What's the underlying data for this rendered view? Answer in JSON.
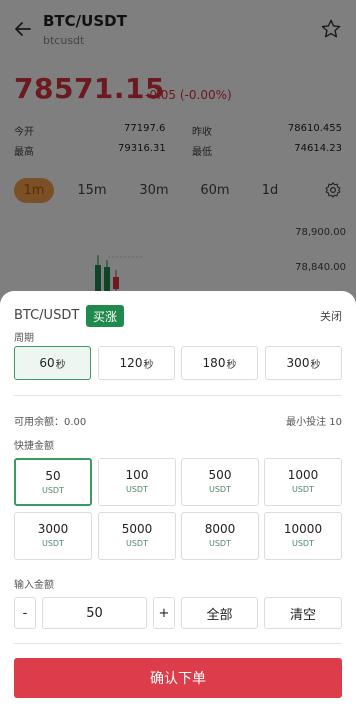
{
  "header": {
    "pair": "BTC/USDT",
    "symbol": "btcusdt"
  },
  "ticker": {
    "last_price": "78571.15",
    "change": "-0.05 (-0.00%)",
    "stats": [
      {
        "label": "今开",
        "value": "77197.6"
      },
      {
        "label": "昨收",
        "value": "78610.455"
      },
      {
        "label": "最高",
        "value": "79316.31"
      },
      {
        "label": "最低",
        "value": "74614.23"
      }
    ]
  },
  "intervals": [
    "1m",
    "15m",
    "30m",
    "60m",
    "1d"
  ],
  "active_interval": "1m",
  "chart": {
    "axis_labels": [
      "78,900.00",
      "78,840.00"
    ],
    "up_color": "#1f8a4c",
    "down_color": "#d93340"
  },
  "order_sheet": {
    "pair": "BTC/USDT",
    "direction": "买涨",
    "close_label": "关闭",
    "period_label": "周期",
    "periods": [
      {
        "value": "60",
        "unit": "秒"
      },
      {
        "value": "120",
        "unit": "秒"
      },
      {
        "value": "180",
        "unit": "秒"
      },
      {
        "value": "300",
        "unit": "秒"
      }
    ],
    "selected_period": "60",
    "available_balance": "可用余额：0.00",
    "min_bet": "最小投注 10",
    "quick_amount_label": "快捷金额",
    "amounts": [
      {
        "value": "50",
        "currency": "USDT"
      },
      {
        "value": "100",
        "currency": "USDT"
      },
      {
        "value": "500",
        "currency": "USDT"
      },
      {
        "value": "1000",
        "currency": "USDT"
      },
      {
        "value": "3000",
        "currency": "USDT"
      },
      {
        "value": "5000",
        "currency": "USDT"
      },
      {
        "value": "8000",
        "currency": "USDT"
      },
      {
        "value": "10000",
        "currency": "USDT"
      }
    ],
    "selected_amount": "50",
    "input_label": "输入金额",
    "minus": "-",
    "input_value": "50",
    "plus": "+",
    "all_label": "全部",
    "clear_label": "清空",
    "confirm_label": "确认下单",
    "accent_color": "#1f8a4c",
    "confirm_color": "#dd3d4a"
  }
}
